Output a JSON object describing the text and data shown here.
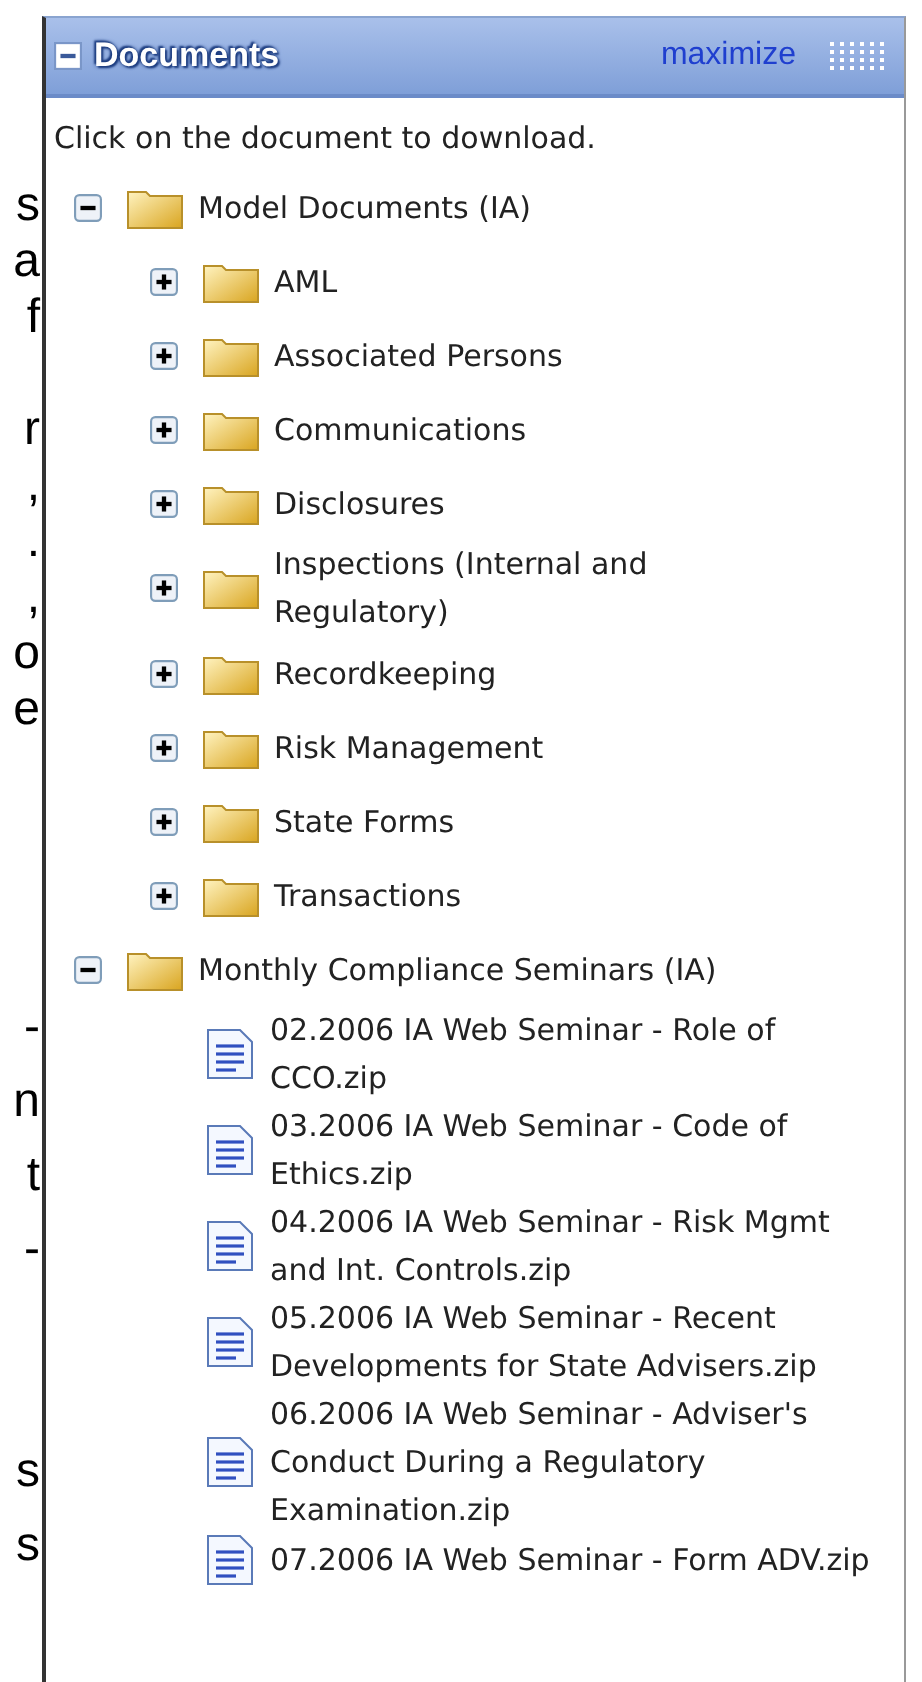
{
  "cut_text": [
    {
      "lines": [
        "s",
        "a",
        "f"
      ]
    },
    {
      "lines": [
        "r",
        ",",
        ".",
        ",",
        "o",
        "e"
      ]
    },
    {
      "lines": [
        "-",
        "n",
        "t",
        "-"
      ]
    },
    {
      "lines": [
        "s",
        "s"
      ]
    }
  ],
  "panel": {
    "title": "Documents",
    "collapsed": false,
    "action": "maximize"
  },
  "instructions": "Click on the document to download.",
  "tree": [
    {
      "kind": "folder",
      "label": "Model Documents (IA)",
      "expanded": true,
      "children": [
        {
          "kind": "folder",
          "label": "AML",
          "expanded": false
        },
        {
          "kind": "folder",
          "label": "Associated Persons",
          "expanded": false
        },
        {
          "kind": "folder",
          "label": "Communications",
          "expanded": false
        },
        {
          "kind": "folder",
          "label": "Disclosures",
          "expanded": false
        },
        {
          "kind": "folder",
          "label": "Inspections (Internal and Regulatory)",
          "expanded": false
        },
        {
          "kind": "folder",
          "label": "Recordkeeping",
          "expanded": false
        },
        {
          "kind": "folder",
          "label": "Risk Management",
          "expanded": false
        },
        {
          "kind": "folder",
          "label": "State Forms",
          "expanded": false
        },
        {
          "kind": "folder",
          "label": "Transactions",
          "expanded": false
        }
      ]
    },
    {
      "kind": "folder",
      "label": "Monthly Compliance Seminars (IA)",
      "expanded": true,
      "children": [
        {
          "kind": "file",
          "label": "02.2006 IA Web Seminar - Role of CCO.zip"
        },
        {
          "kind": "file",
          "label": "03.2006 IA Web Seminar - Code of Ethics.zip"
        },
        {
          "kind": "file",
          "label": "04.2006 IA Web Seminar - Risk Mgmt and Int. Controls.zip"
        },
        {
          "kind": "file",
          "label": "05.2006 IA Web Seminar - Recent Developments for State Advisers.zip"
        },
        {
          "kind": "file",
          "label": "06.2006 IA Web Seminar - Adviser's Conduct During a Regulatory Examination.zip"
        },
        {
          "kind": "file",
          "label": "07.2006 IA Web Seminar - Form ADV.zip"
        }
      ]
    }
  ]
}
